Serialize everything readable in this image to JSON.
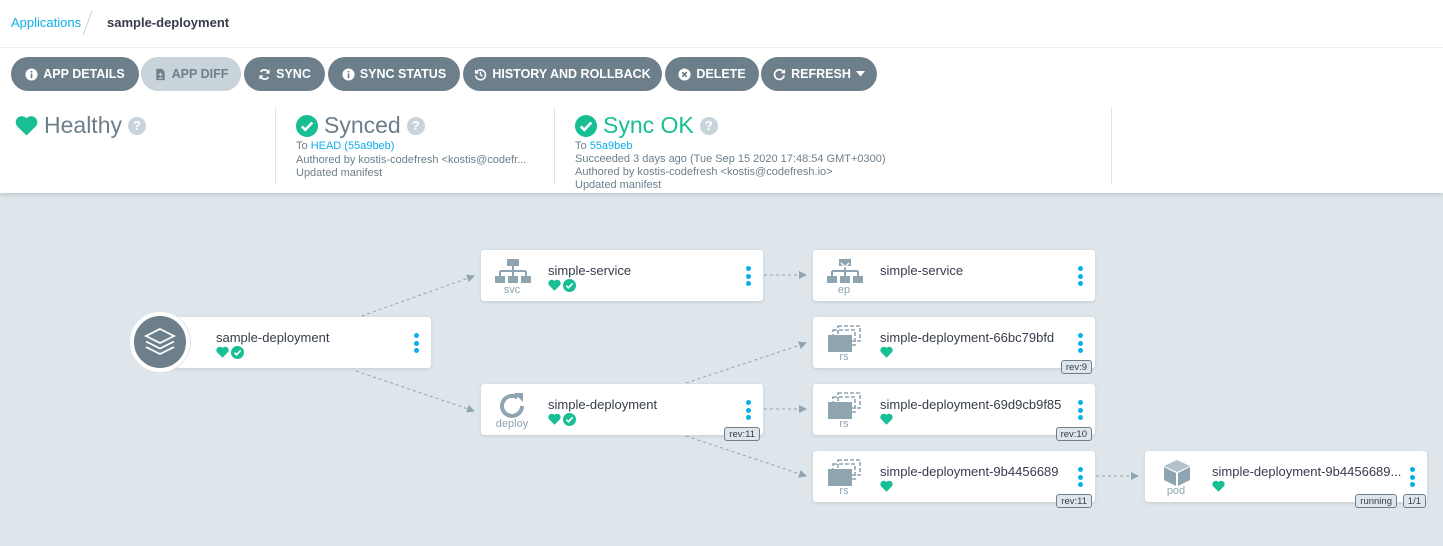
{
  "breadcrumb": {
    "root": "Applications",
    "current": "sample-deployment"
  },
  "toolbar": {
    "app_details": "APP DETAILS",
    "app_diff": "APP DIFF",
    "sync": "SYNC",
    "sync_status": "SYNC STATUS",
    "history": "HISTORY AND ROLLBACK",
    "delete": "DELETE",
    "refresh": "REFRESH"
  },
  "status": {
    "health": {
      "label": "Healthy"
    },
    "sync": {
      "label": "Synced",
      "to_prefix": "To",
      "revision": "HEAD (55a9beb)",
      "authored": "Authored by kostis-codefresh <kostis@codefr...",
      "message": "Updated manifest"
    },
    "operation": {
      "label": "Sync OK",
      "to_prefix": "To",
      "revision": "55a9beb",
      "succeeded": "Succeeded 3 days ago (Tue Sep 15 2020 17:48:54 GMT+0300)",
      "authored": "Authored by kostis-codefresh <kostis@codefresh.io>",
      "message": "Updated manifest"
    }
  },
  "graph": {
    "app": {
      "name": "sample-deployment"
    },
    "nodes": [
      {
        "name": "simple-service",
        "kind": "svc",
        "health": "healthy",
        "synced": true,
        "tags": []
      },
      {
        "name": "simple-deployment",
        "kind": "deploy",
        "health": "healthy",
        "synced": true,
        "tags": [
          "rev:11"
        ]
      },
      {
        "name": "simple-service",
        "kind": "ep",
        "health": null,
        "synced": false,
        "tags": []
      },
      {
        "name": "simple-deployment-66bc79bfd",
        "kind": "rs",
        "health": "healthy",
        "synced": false,
        "tags": [
          "rev:9"
        ]
      },
      {
        "name": "simple-deployment-69d9cb9f85",
        "kind": "rs",
        "health": "healthy",
        "synced": false,
        "tags": [
          "rev:10"
        ]
      },
      {
        "name": "simple-deployment-9b4456689",
        "kind": "rs",
        "health": "healthy",
        "synced": false,
        "tags": [
          "rev:11"
        ]
      },
      {
        "name": "simple-deployment-9b4456689...",
        "kind": "pod",
        "health": "healthy",
        "synced": false,
        "tags": [
          "running",
          "1/1"
        ]
      }
    ]
  },
  "colors": {
    "accent": "#0dadea",
    "healthy": "#18be94",
    "button": "#6d7f8b",
    "canvas": "#dee6eb"
  }
}
